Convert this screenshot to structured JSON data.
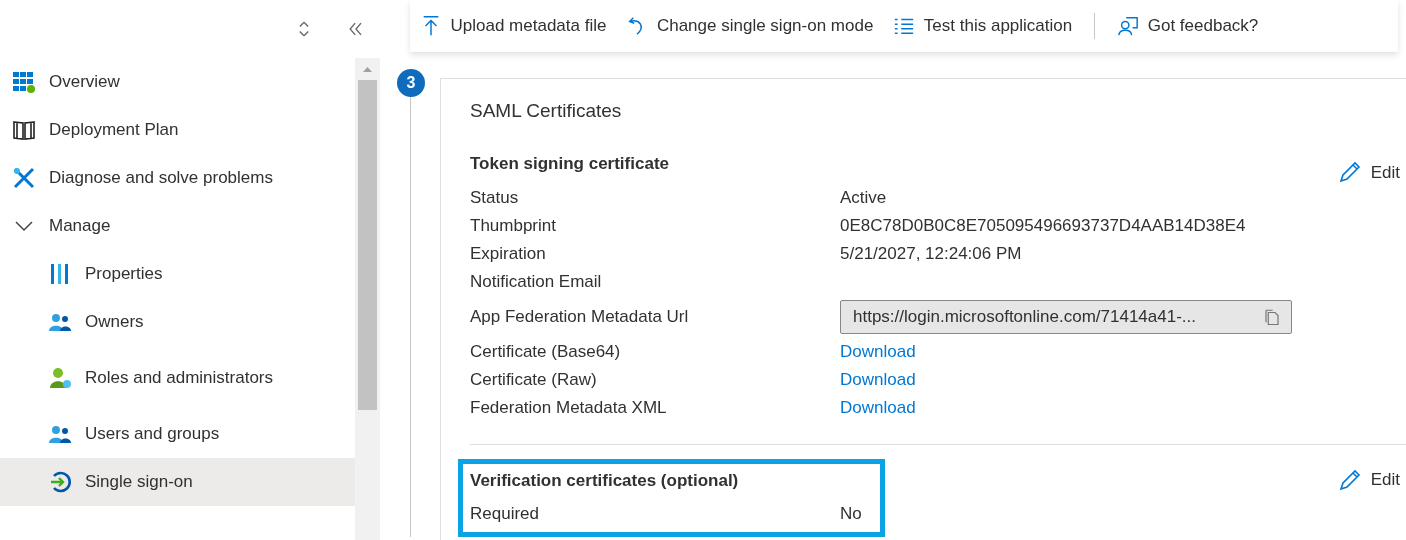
{
  "sidebar": {
    "items": [
      {
        "label": "Overview",
        "kind": "link",
        "selected": false
      },
      {
        "label": "Deployment Plan",
        "kind": "link",
        "selected": false
      },
      {
        "label": "Diagnose and solve problems",
        "kind": "link",
        "selected": false
      },
      {
        "label": "Manage",
        "kind": "group",
        "expanded": true,
        "children": [
          {
            "label": "Properties",
            "selected": false
          },
          {
            "label": "Owners",
            "selected": false
          },
          {
            "label": "Roles and administrators",
            "selected": false
          },
          {
            "label": "Users and groups",
            "selected": false
          },
          {
            "label": "Single sign-on",
            "selected": true
          }
        ]
      }
    ]
  },
  "toolbar": {
    "items": [
      {
        "label": "Upload metadata file",
        "kind": "upload"
      },
      {
        "label": "Change single sign-on mode",
        "kind": "undo"
      },
      {
        "label": "Test this application",
        "kind": "list"
      },
      {
        "label": "Got feedback?",
        "kind": "feedback"
      }
    ]
  },
  "step": {
    "number": "3",
    "title": "SAML Certificates",
    "sections": [
      {
        "heading": "Token signing certificate",
        "edit": "Edit",
        "highlighted": false,
        "fields": [
          {
            "label": "Status",
            "kind": "text",
            "value": "Active"
          },
          {
            "label": "Thumbprint",
            "kind": "text",
            "value": "0E8C78D0B0C8E705095496693737D4AAB14D38E4"
          },
          {
            "label": "Expiration",
            "kind": "text",
            "value": "5/21/2027, 12:24:06 PM"
          },
          {
            "label": "Notification Email",
            "kind": "text"
          },
          {
            "label": "App Federation Metadata Url",
            "kind": "url",
            "value": "https://login.microsoftonline.com/71414a41-..."
          },
          {
            "label": "Certificate (Base64)",
            "kind": "link",
            "value": "Download"
          },
          {
            "label": "Certificate (Raw)",
            "kind": "link",
            "value": "Download"
          },
          {
            "label": "Federation Metadata XML",
            "kind": "link",
            "value": "Download"
          }
        ]
      },
      {
        "heading": "Verification certificates (optional)",
        "edit": "Edit",
        "highlighted": true,
        "fields": [
          {
            "label": "Required",
            "kind": "text",
            "value": "No"
          }
        ]
      }
    ]
  }
}
